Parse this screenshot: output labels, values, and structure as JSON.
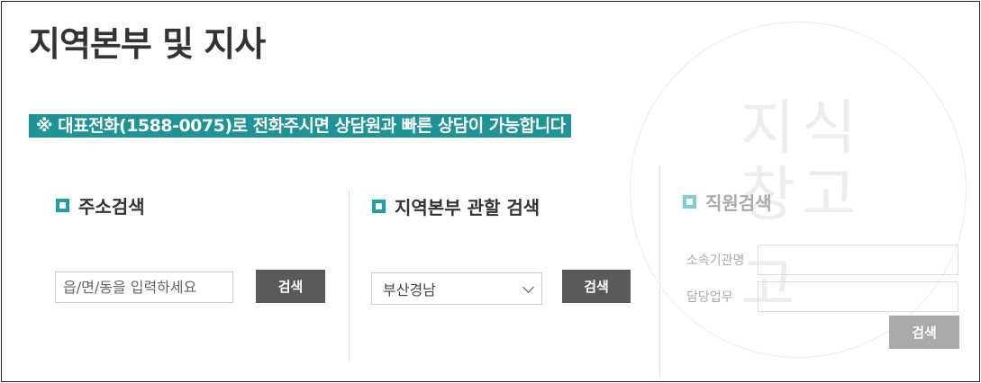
{
  "page": {
    "title": "지역본부 및 지사"
  },
  "notice": {
    "text": "※ 대표전화(1588-0075)로 전화주시면 상담원과 빠른 상담이 가능합니다"
  },
  "address_search": {
    "heading": "주소검색",
    "input_placeholder": "읍/면/동을 입력하세요",
    "button_label": "검색"
  },
  "region_search": {
    "heading": "지역본부 관할 검색",
    "selected_option": "부산경남",
    "button_label": "검색"
  },
  "staff_search": {
    "heading": "직원검색",
    "fields": [
      {
        "label": "소속기관명"
      },
      {
        "label": "담당업무"
      }
    ],
    "button_label": "검색"
  },
  "watermark": {
    "chars": [
      "지",
      "식",
      "창",
      "고",
      "고"
    ]
  },
  "colors": {
    "accent": "#1f9496",
    "button_dark": "#5a5a5a",
    "button_light": "#a9a9a9"
  }
}
